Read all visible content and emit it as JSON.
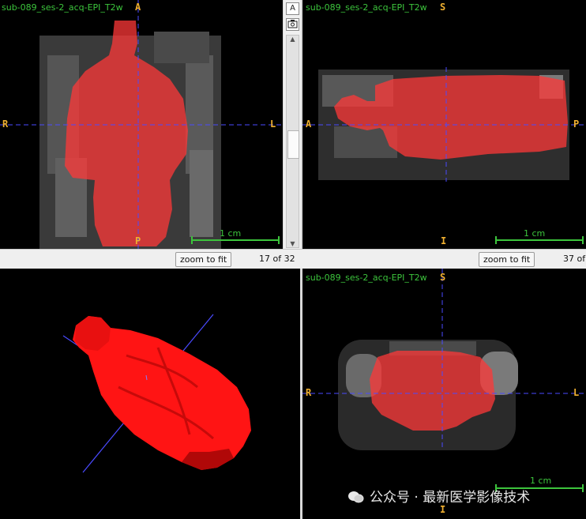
{
  "views": {
    "coronal": {
      "title": "sub-089_ses-2_acq-EPI_T2w",
      "top": "A",
      "bottom": "P",
      "left": "R",
      "right": "L",
      "scale": "1 cm",
      "zoom_label": "zoom to fit",
      "slice": "17 of 32"
    },
    "sagittal": {
      "title": "sub-089_ses-2_acq-EPI_T2w",
      "top": "S",
      "bottom": "I",
      "left": "A",
      "right": "P",
      "scale": "1 cm",
      "zoom_label": "zoom to fit",
      "slice": "37 of"
    },
    "axial": {
      "title": "sub-089_ses-2_acq-EPI_T2w",
      "top": "S",
      "bottom": "I",
      "left": "R",
      "right": "L",
      "scale": "1 cm"
    }
  },
  "toolbar": {
    "text_toggle": "A",
    "camera": "camera-icon"
  },
  "watermark": "公众号 · 最新医学影像技术",
  "colors": {
    "overlay": "#ff3030",
    "crosshair": "#4a4aff",
    "orientation": "#f0b030",
    "title": "#3cc43c"
  }
}
